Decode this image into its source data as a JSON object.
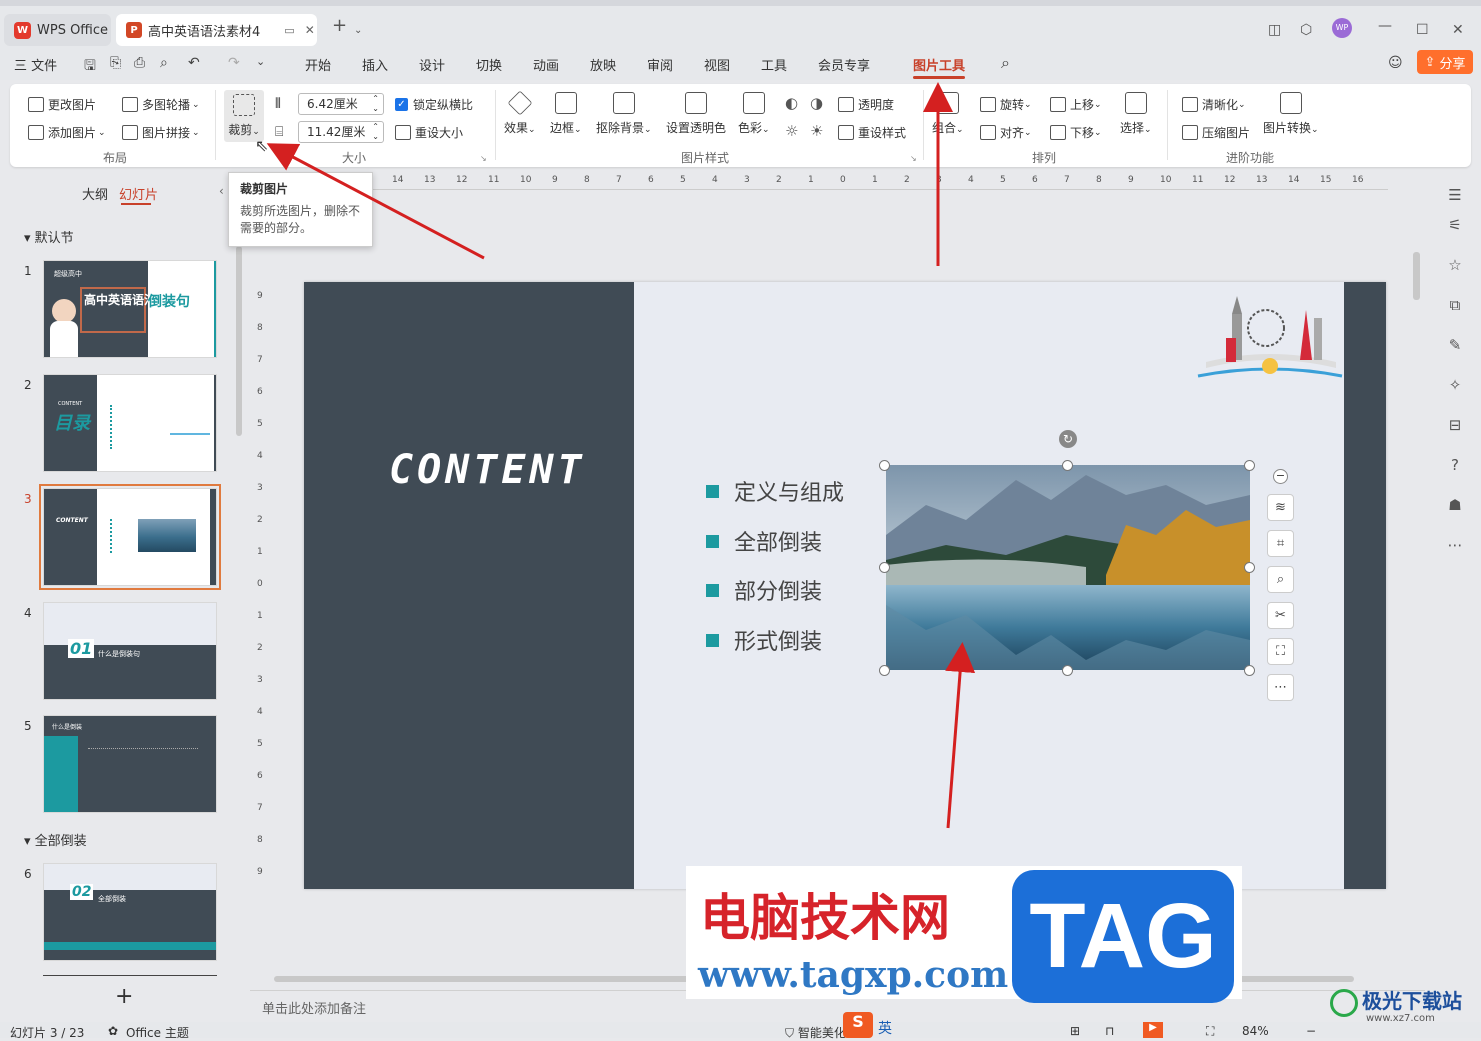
{
  "titlebar": {
    "tabs": [
      {
        "label": "WPS Office"
      },
      {
        "label": "高中英语语法素材4"
      }
    ],
    "avatar": "WP"
  },
  "menubar": {
    "file": "三 文件",
    "items": [
      "开始",
      "插入",
      "设计",
      "切换",
      "动画",
      "放映",
      "审阅",
      "视图",
      "工具",
      "会员专享",
      "图片工具"
    ],
    "share": "分享"
  },
  "ribbon": {
    "layout": {
      "change_picture": "更改图片",
      "multi_carousel": "多图轮播",
      "add_picture": "添加图片",
      "picture_collage": "图片拼接",
      "crop": "裁剪",
      "group_label": "布局"
    },
    "size": {
      "width": "6.42厘米",
      "height": "11.42厘米",
      "lock_ratio": "锁定纵横比",
      "reset_size": "重设大小",
      "group_label": "大小"
    },
    "style": {
      "effects": "效果",
      "border": "边框",
      "remove_bg": "抠除背景",
      "set_transparent": "设置透明色",
      "color": "色彩",
      "transparency": "透明度",
      "reset_style": "重设样式",
      "group_label": "图片样式"
    },
    "arrange": {
      "combine": "组合",
      "rotate": "旋转",
      "align": "对齐",
      "bring_forward": "上移",
      "send_backward": "下移",
      "select": "选择",
      "group_label": "排列"
    },
    "advanced": {
      "sharpen": "清晰化",
      "compress": "压缩图片",
      "convert": "图片转换",
      "group_label": "进阶功能"
    }
  },
  "tooltip": {
    "title": "裁剪图片",
    "desc": "裁剪所选图片，删除不需要的部分。"
  },
  "leftpanel": {
    "tabs": [
      "大纲",
      "幻灯片"
    ],
    "section1": "默认节",
    "section2": "全部倒装",
    "slide_numbers": [
      "1",
      "2",
      "3",
      "4",
      "5",
      "6"
    ],
    "add": "+"
  },
  "thumbs": {
    "s1": {
      "title": "高中英语语法",
      "title2": "倒装句",
      "tag": "超级高中"
    },
    "s2": {
      "title": "目录",
      "en": "CONTENT"
    },
    "s3": {
      "en": "CONTENT"
    },
    "s4": {
      "num": "01",
      "sub": "什么是倒装句"
    },
    "s5": {
      "title": "什么是倒装"
    },
    "s6": {
      "num": "02",
      "sub": "全部倒装"
    }
  },
  "ruler": {
    "h_ticks": [
      "14",
      "13",
      "12",
      "11",
      "10",
      "9",
      "8",
      "7",
      "6",
      "5",
      "4",
      "3",
      "2",
      "1",
      "0",
      "1",
      "2",
      "3",
      "4",
      "5",
      "6",
      "7",
      "8",
      "9",
      "10",
      "11",
      "12",
      "13",
      "14",
      "15",
      "16"
    ],
    "v_ticks": [
      "9",
      "8",
      "7",
      "6",
      "5",
      "4",
      "3",
      "2",
      "1",
      "0",
      "1",
      "2",
      "3",
      "4",
      "5",
      "6",
      "7",
      "8",
      "9"
    ]
  },
  "slide": {
    "title": "CONTENT",
    "bullets": [
      "定义与组成",
      "全部倒装",
      "部分倒装",
      "形式倒装"
    ]
  },
  "notes": {
    "placeholder": "单击此处添加备注"
  },
  "status": {
    "slide_info": "幻灯片 3 / 23",
    "theme": "Office 主题",
    "smart": "智能美化",
    "ime": "英",
    "zoom": "84%"
  },
  "watermark": {
    "cn": "电脑技术网",
    "url": "www.tagxp.com",
    "tag": "TAG",
    "logo2": "极光下载站",
    "logo2_url": "www.xz7.com"
  },
  "colors": {
    "accent": "#c8412a",
    "teal": "#1c9aa0",
    "dark": "#404b55",
    "share": "#ff6f2c",
    "arrow": "#d42020"
  }
}
